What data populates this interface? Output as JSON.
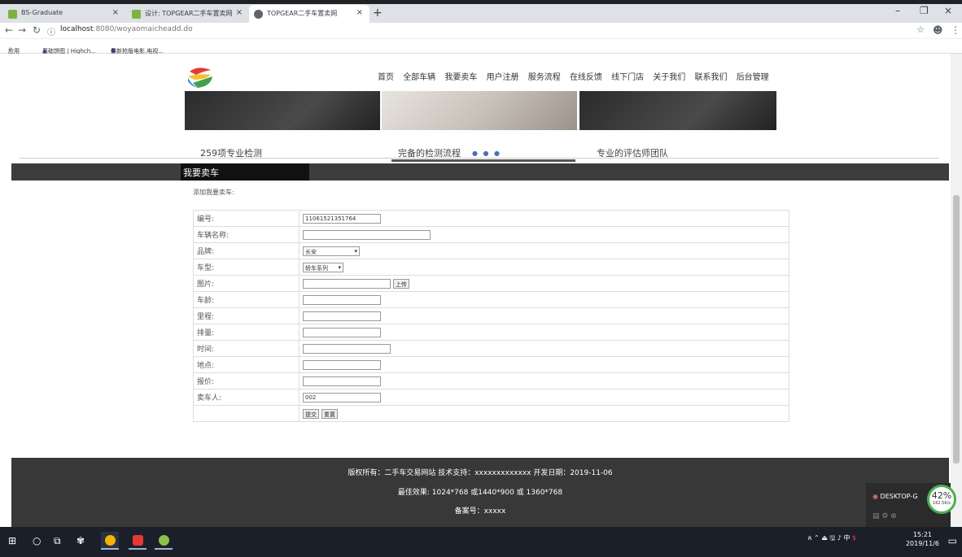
{
  "browser": {
    "tabs": [
      {
        "title": "BS-Graduate",
        "active": false
      },
      {
        "title": "设计: TOPGEAR二手车置卖网",
        "active": false
      },
      {
        "title": "TOPGEAR二手车置卖网",
        "active": true
      }
    ],
    "url_host": "localhost",
    "url_path": ":8080/woyaomaicheadd.do",
    "bookmarks": [
      "应用",
      "基础饼图 | Highch...",
      "最新抢版电影,电视..."
    ]
  },
  "site": {
    "nav": [
      "首页",
      "全部车辆",
      "我要卖车",
      "用户注册",
      "服务流程",
      "在线反馈",
      "线下门店",
      "关于我们",
      "联系我们",
      "后台管理"
    ],
    "features": [
      "259项专业检测",
      "完备的检测流程",
      "专业的评估师团队"
    ],
    "section_title": "我要卖车",
    "subtitle": "添加我要卖车:"
  },
  "form": {
    "rows": [
      {
        "label": "编号:",
        "value": "11061521351764"
      },
      {
        "label": "车辆名称:",
        "value": ""
      },
      {
        "label": "品牌:",
        "value": "长安"
      },
      {
        "label": "车型:",
        "value": "轿车系列"
      },
      {
        "label": "图片:",
        "value": ""
      },
      {
        "label": "车龄:",
        "value": ""
      },
      {
        "label": "里程:",
        "value": ""
      },
      {
        "label": "排量:",
        "value": ""
      },
      {
        "label": "时间:",
        "value": ""
      },
      {
        "label": "地点:",
        "value": ""
      },
      {
        "label": "报价:",
        "value": ""
      },
      {
        "label": "卖车人:",
        "value": "002"
      }
    ],
    "upload_label": "上传",
    "submit_label": "提交",
    "reset_label": "重置"
  },
  "footer": {
    "line1": "版权所有：二手车交易网站 技术支持：xxxxxxxxxxxxx 开发日期：2019-11-06",
    "line2": "最佳效果: 1024*768 或1440*900 或 1360*768",
    "line3": "备案号：xxxxx"
  },
  "overlay": {
    "device": "DESKTOP-G",
    "percent": "42%",
    "speed": "162.5K/s"
  },
  "taskbar": {
    "ime": "中",
    "time": "15:21",
    "date": "2019/11/6"
  },
  "colors": {
    "section_bar": "#3d3d3d",
    "footer": "#383838",
    "taskbar": "#1b1f2a"
  }
}
